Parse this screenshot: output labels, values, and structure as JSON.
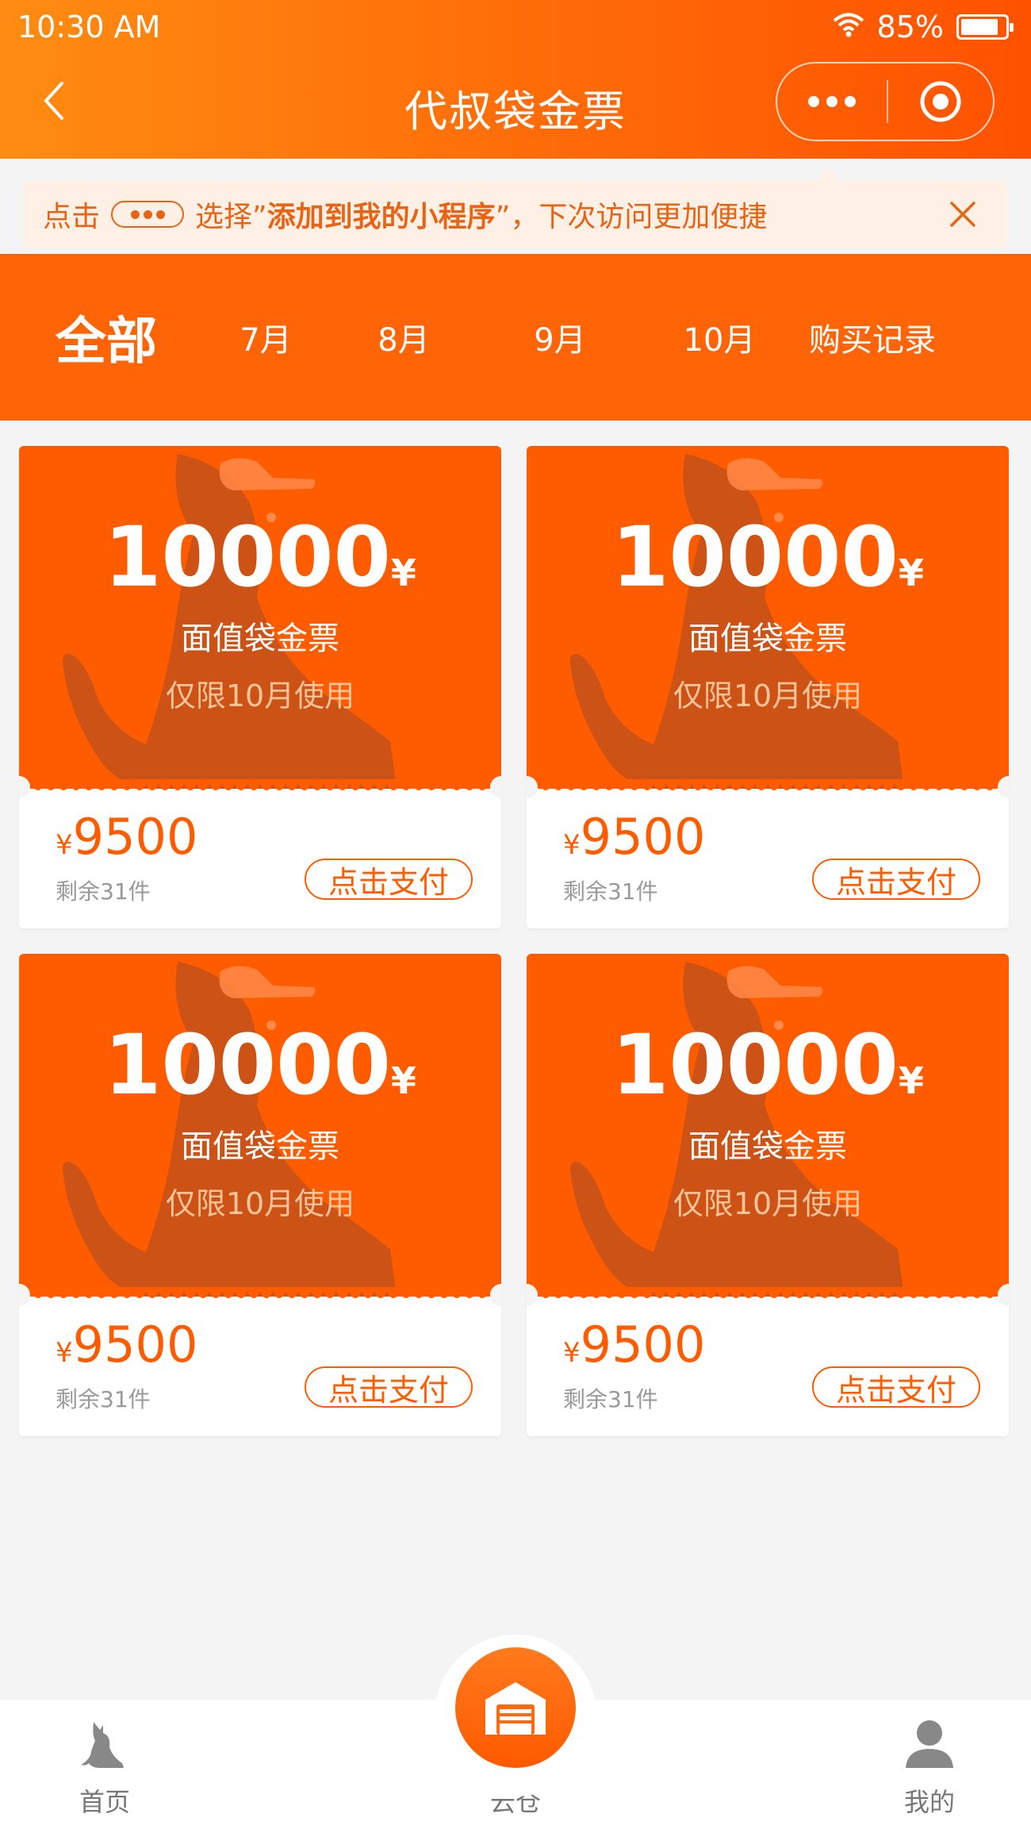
{
  "status_bar": {
    "time": "10:30 AM",
    "battery": "85%",
    "battery_level": 0.85
  },
  "header": {
    "title": "代叔袋金票"
  },
  "hint": {
    "prefix": "点击",
    "middle": "选择”",
    "bold": "添加到我的小程序",
    "suffix": "”，下次访问更加便捷"
  },
  "tabs": [
    {
      "label": "全部",
      "active": true
    },
    {
      "label": "7月"
    },
    {
      "label": "8月"
    },
    {
      "label": "9月"
    },
    {
      "label": "10月"
    },
    {
      "label": "购买记录"
    }
  ],
  "cards": [
    {
      "amount": "10000",
      "currency": "¥",
      "face_label": "面值袋金票",
      "limit": "仅限10月使用",
      "price_currency": "¥",
      "price": "9500",
      "stock": "剩余31件",
      "pay_label": "点击支付"
    },
    {
      "amount": "10000",
      "currency": "¥",
      "face_label": "面值袋金票",
      "limit": "仅限10月使用",
      "price_currency": "¥",
      "price": "9500",
      "stock": "剩余31件",
      "pay_label": "点击支付"
    },
    {
      "amount": "10000",
      "currency": "¥",
      "face_label": "面值袋金票",
      "limit": "仅限10月使用",
      "price_currency": "¥",
      "price": "9500",
      "stock": "剩余31件",
      "pay_label": "点击支付"
    },
    {
      "amount": "10000",
      "currency": "¥",
      "face_label": "面值袋金票",
      "limit": "仅限10月使用",
      "price_currency": "¥",
      "price": "9500",
      "stock": "剩余31件",
      "pay_label": "点击支付"
    }
  ],
  "bottom_nav": {
    "home": {
      "label": "首页",
      "icon": "kangaroo-icon"
    },
    "center": {
      "label": "云仓",
      "icon": "warehouse-icon"
    },
    "mine": {
      "label": "我的",
      "icon": "user-icon"
    }
  },
  "colors": {
    "brand": "#ff5c00",
    "header_start": "#ff8c12",
    "tab_bar": "#ff6407",
    "hint_bg": "#fff0e6"
  }
}
